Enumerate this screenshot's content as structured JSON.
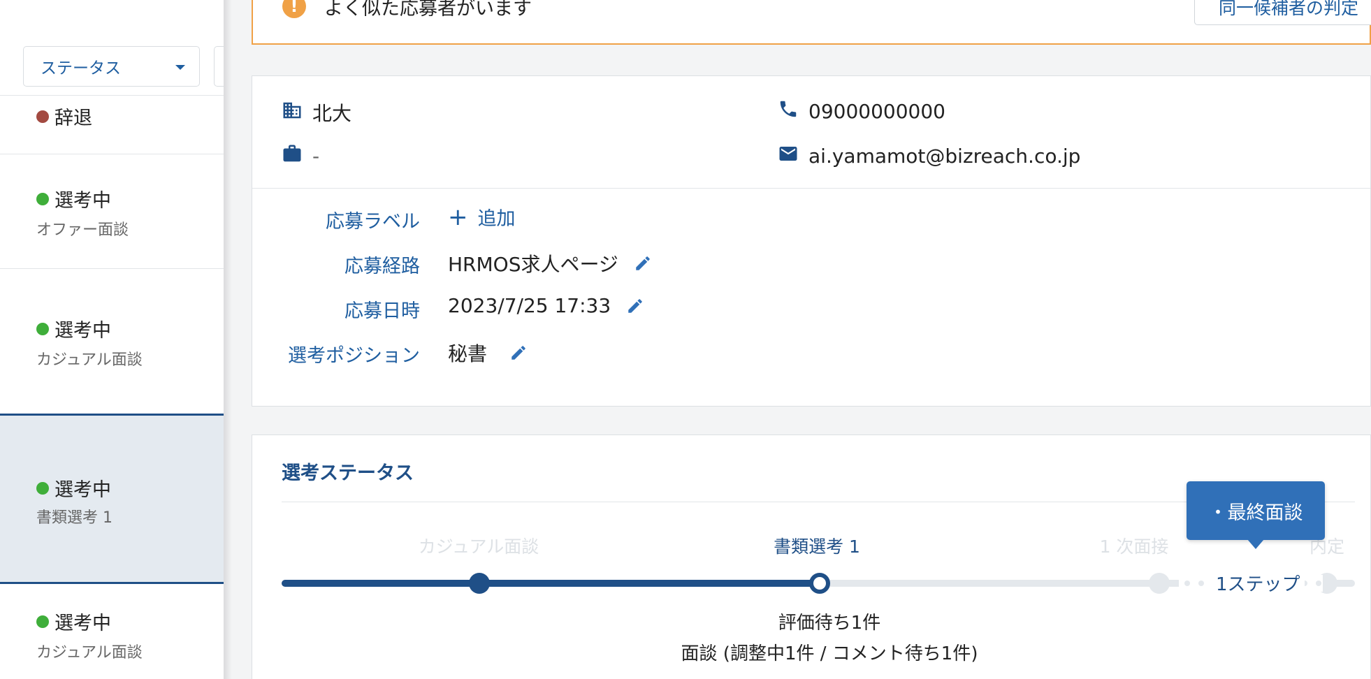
{
  "filter": {
    "status_label": "ステータス"
  },
  "applicants": [
    {
      "status": "辞退",
      "stage": ""
    },
    {
      "status": "選考中",
      "stage": "オファー面談"
    },
    {
      "status": "選考中",
      "stage": "カジュアル面談"
    },
    {
      "status": "選考中",
      "stage": "書類選考 1"
    },
    {
      "status": "選考中",
      "stage": "カジュアル面談"
    }
  ],
  "alert": {
    "message": "よく似た応募者がいます",
    "icon": "!",
    "button_label": "同一候補者の判定"
  },
  "candidate": {
    "school": "北大",
    "company": "-",
    "phone": "09000000000",
    "email": "ai.yamamot@bizreach.co.jp"
  },
  "application": {
    "label_label": "応募ラベル",
    "add_label": "追加",
    "route_label": "応募経路",
    "route_value": "HRMOS求人ページ",
    "date_label": "応募日時",
    "date_value": "2023/7/25 17:33",
    "position_label": "選考ポジション",
    "position_value": "秘書"
  },
  "selection": {
    "title": "選考ステータス",
    "steps": [
      "カジュアル面談",
      "書類選考 1",
      "1 次面接",
      "内定"
    ],
    "tooltip": "・最終面談",
    "skip_label": "1ステップ",
    "eval_text": "評価待ち1件",
    "meeting_text": "面談 (調整中1件 / コメント待ち1件)"
  },
  "colors": {
    "accent": "#1f4f87",
    "link": "#1f5ea0",
    "warning": "#f0a146",
    "active": "#3fae3a",
    "declined": "#a34a41"
  }
}
